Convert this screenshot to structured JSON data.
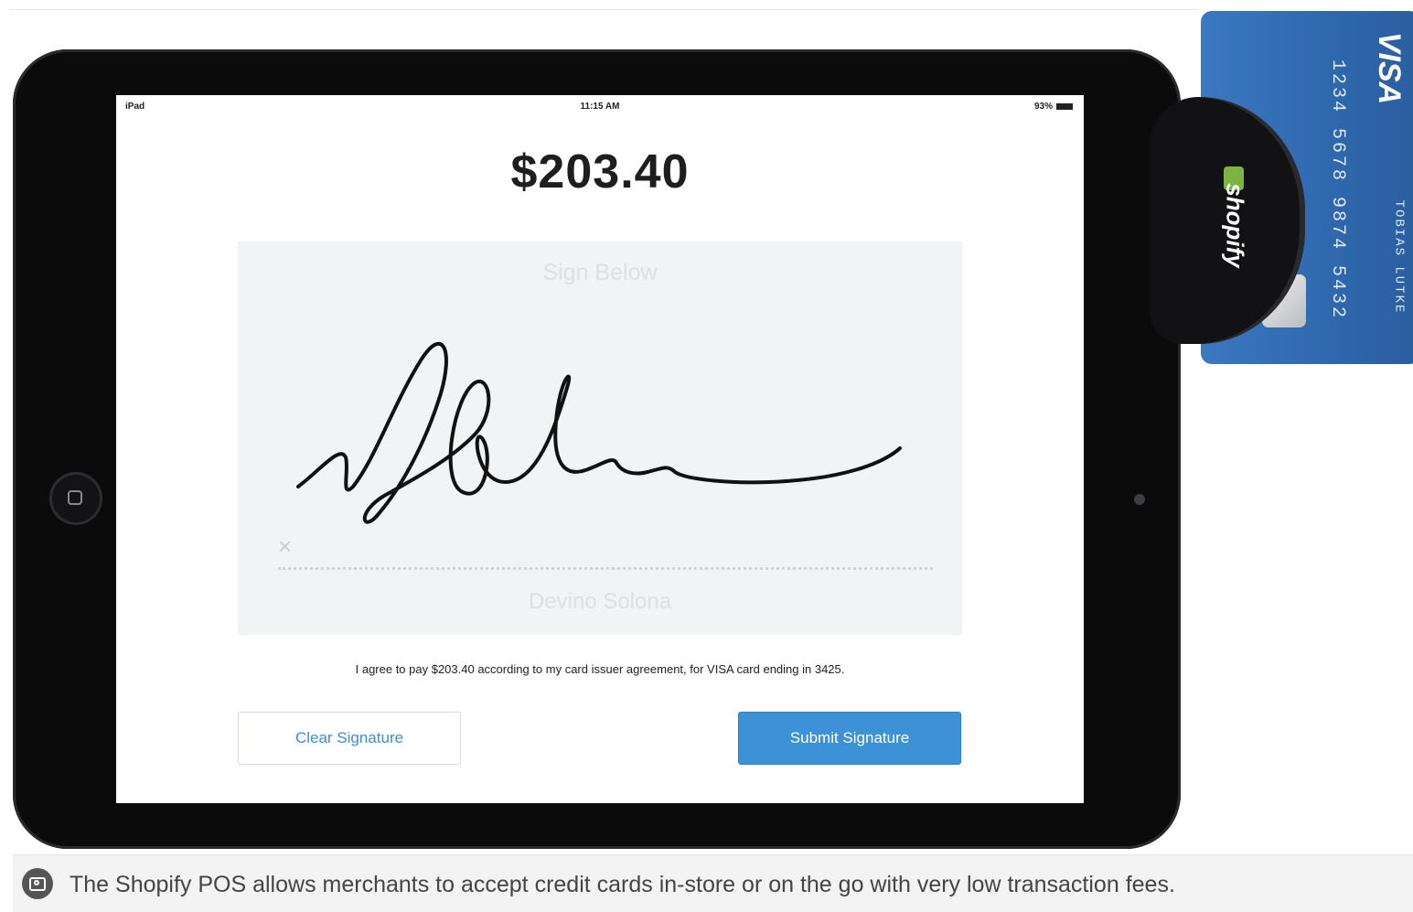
{
  "status_bar": {
    "carrier": "iPad",
    "time": "11:15 AM",
    "battery": "93%"
  },
  "payment": {
    "amount": "$203.40",
    "sign_prompt": "Sign Below",
    "x_mark": "×",
    "signer_name": "Devino Solona",
    "agreement": "I agree to pay $203.40 according to my card issuer agreement, for VISA card ending in 3425."
  },
  "buttons": {
    "clear": "Clear Signature",
    "submit": "Submit Signature"
  },
  "card": {
    "brand": "VISA",
    "number": "1234 5678 9874 5432",
    "holder": "TOBIAS LUTKE"
  },
  "reader": {
    "brand": "shopify"
  },
  "caption": {
    "text": "The Shopify POS allows merchants to accept credit cards in-store or on the go with very low transaction fees."
  },
  "colors": {
    "submit_button": "#3d91d6",
    "clear_text": "#3d8ed6",
    "card_blue": "#2f68ad",
    "pad_bg": "#f1f3f5"
  }
}
